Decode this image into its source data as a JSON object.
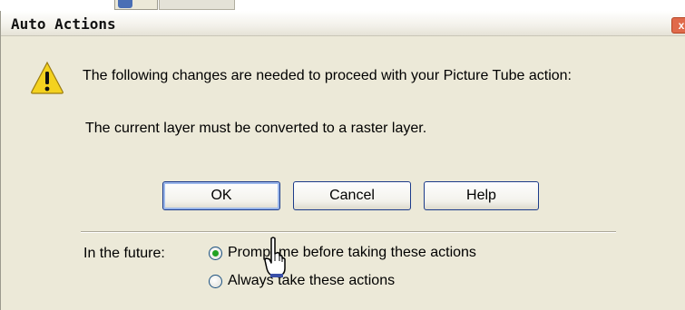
{
  "dialog": {
    "title": "Auto Actions",
    "close_glyph": "x",
    "icon": "warning-icon",
    "message": "The following changes are needed to proceed with your Picture Tube action:",
    "detail": "The current layer must be converted to a raster layer."
  },
  "buttons": {
    "ok": "OK",
    "cancel": "Cancel",
    "help": "Help"
  },
  "future": {
    "label": "In the future:",
    "options": [
      {
        "label": "Prompt me before taking these actions",
        "selected": true
      },
      {
        "label": "Always take these actions",
        "selected": false
      }
    ]
  },
  "colors": {
    "dialog_bg": "#ece9d8",
    "button_border": "#1c3b8a",
    "radio_selected": "#21a121",
    "warning_fill": "#f4d21f"
  }
}
